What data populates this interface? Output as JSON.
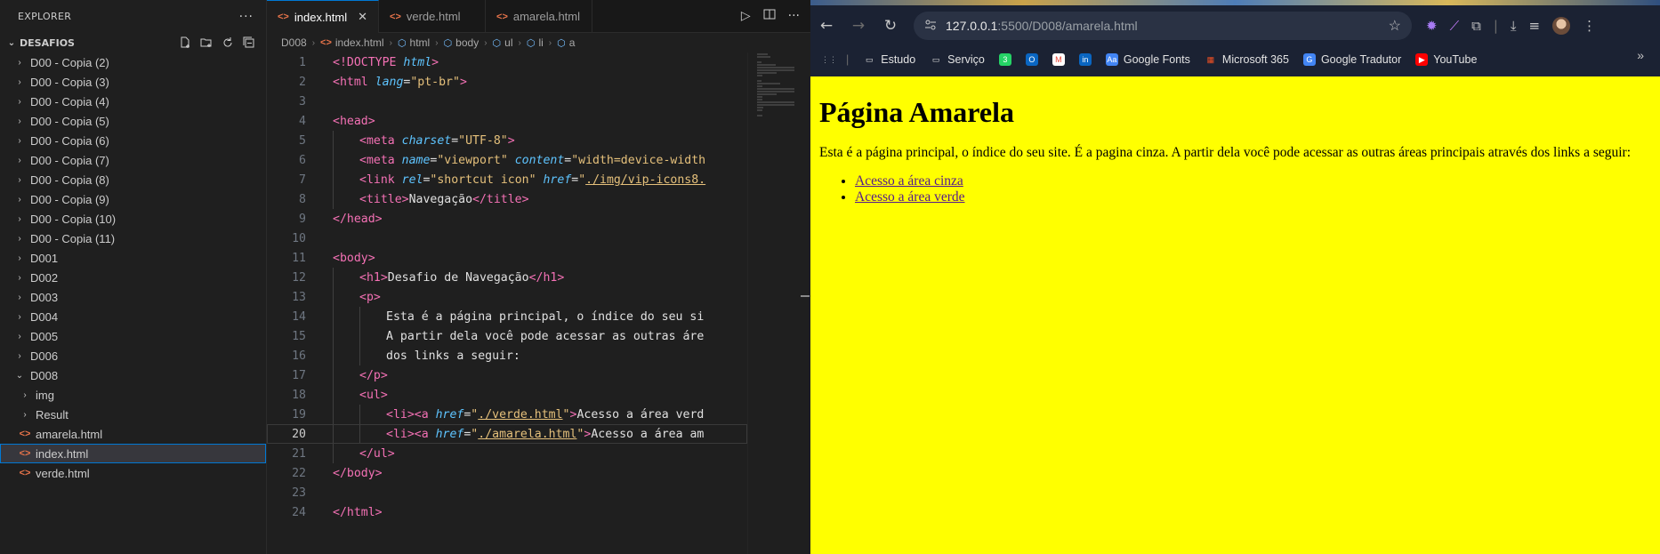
{
  "explorer": {
    "title": "EXPLORER",
    "more": "···",
    "folder": "DESAFIOS",
    "items": [
      {
        "label": "D00 - Copia (2)",
        "kind": "folder",
        "open": false,
        "depth": 1
      },
      {
        "label": "D00 - Copia (3)",
        "kind": "folder",
        "open": false,
        "depth": 1
      },
      {
        "label": "D00 - Copia (4)",
        "kind": "folder",
        "open": false,
        "depth": 1
      },
      {
        "label": "D00 - Copia (5)",
        "kind": "folder",
        "open": false,
        "depth": 1
      },
      {
        "label": "D00 - Copia (6)",
        "kind": "folder",
        "open": false,
        "depth": 1
      },
      {
        "label": "D00 - Copia (7)",
        "kind": "folder",
        "open": false,
        "depth": 1
      },
      {
        "label": "D00 - Copia (8)",
        "kind": "folder",
        "open": false,
        "depth": 1
      },
      {
        "label": "D00 - Copia (9)",
        "kind": "folder",
        "open": false,
        "depth": 1
      },
      {
        "label": "D00 - Copia (10)",
        "kind": "folder",
        "open": false,
        "depth": 1
      },
      {
        "label": "D00 - Copia (11)",
        "kind": "folder",
        "open": false,
        "depth": 1
      },
      {
        "label": "D001",
        "kind": "folder",
        "open": false,
        "depth": 1
      },
      {
        "label": "D002",
        "kind": "folder",
        "open": false,
        "depth": 1
      },
      {
        "label": "D003",
        "kind": "folder",
        "open": false,
        "depth": 1
      },
      {
        "label": "D004",
        "kind": "folder",
        "open": false,
        "depth": 1
      },
      {
        "label": "D005",
        "kind": "folder",
        "open": false,
        "depth": 1
      },
      {
        "label": "D006",
        "kind": "folder",
        "open": false,
        "depth": 1
      },
      {
        "label": "D008",
        "kind": "folder",
        "open": true,
        "depth": 1
      },
      {
        "label": "img",
        "kind": "folder",
        "open": false,
        "depth": 2
      },
      {
        "label": "Result",
        "kind": "folder",
        "open": false,
        "depth": 2
      },
      {
        "label": "amarela.html",
        "kind": "file",
        "depth": 2
      },
      {
        "label": "index.html",
        "kind": "file",
        "depth": 2,
        "selected": true
      },
      {
        "label": "verde.html",
        "kind": "file",
        "depth": 2
      }
    ]
  },
  "tabs": [
    {
      "label": "index.html",
      "active": true
    },
    {
      "label": "verde.html",
      "active": false
    },
    {
      "label": "amarela.html",
      "active": false
    }
  ],
  "breadcrumb": [
    "D008",
    "index.html",
    "html",
    "body",
    "ul",
    "li",
    "a"
  ],
  "code_lines": [
    [
      [
        "t-doc",
        "<!DOCTYPE "
      ],
      [
        "t-dochtml",
        "html"
      ],
      [
        "t-doc",
        ">"
      ]
    ],
    [
      [
        "t-tag",
        "<html "
      ],
      [
        "t-attr",
        "lang"
      ],
      [
        "t-text",
        "="
      ],
      [
        "t-str",
        "\"pt-br\""
      ],
      [
        "t-tag",
        ">"
      ]
    ],
    [],
    [
      [
        "t-tag",
        "<head>"
      ]
    ],
    [
      [
        "g",
        ""
      ],
      [
        "t-tag",
        "<meta "
      ],
      [
        "t-attr",
        "charset"
      ],
      [
        "t-text",
        "="
      ],
      [
        "t-str",
        "\"UTF-8\""
      ],
      [
        "t-tag",
        ">"
      ]
    ],
    [
      [
        "g",
        ""
      ],
      [
        "t-tag",
        "<meta "
      ],
      [
        "t-attr",
        "name"
      ],
      [
        "t-text",
        "="
      ],
      [
        "t-str",
        "\"viewport\" "
      ],
      [
        "t-attr",
        "content"
      ],
      [
        "t-text",
        "="
      ],
      [
        "t-str",
        "\"width=device-width"
      ]
    ],
    [
      [
        "g",
        ""
      ],
      [
        "t-tag",
        "<link "
      ],
      [
        "t-attr",
        "rel"
      ],
      [
        "t-text",
        "="
      ],
      [
        "t-str",
        "\"shortcut icon\" "
      ],
      [
        "t-attr",
        "href"
      ],
      [
        "t-text",
        "="
      ],
      [
        "t-str",
        "\""
      ],
      [
        "t-str t-link",
        "./img/vip-icons8."
      ]
    ],
    [
      [
        "g",
        ""
      ],
      [
        "t-tag",
        "<title>"
      ],
      [
        "t-text",
        "Navegação"
      ],
      [
        "t-tag",
        "</title>"
      ]
    ],
    [
      [
        "t-tag",
        "</head>"
      ]
    ],
    [],
    [
      [
        "t-tag",
        "<body>"
      ]
    ],
    [
      [
        "g",
        ""
      ],
      [
        "t-tag",
        "<h1>"
      ],
      [
        "t-text",
        "Desafio de Navegação"
      ],
      [
        "t-tag",
        "</h1>"
      ]
    ],
    [
      [
        "g",
        ""
      ],
      [
        "t-tag",
        "<p>"
      ]
    ],
    [
      [
        "g",
        ""
      ],
      [
        "g",
        ""
      ],
      [
        "t-text",
        "Esta é a página principal, o índice do seu si"
      ]
    ],
    [
      [
        "g",
        ""
      ],
      [
        "g",
        ""
      ],
      [
        "t-text",
        "A partir dela você pode acessar as outras áre"
      ]
    ],
    [
      [
        "g",
        ""
      ],
      [
        "g",
        ""
      ],
      [
        "t-text",
        "dos links a seguir:"
      ]
    ],
    [
      [
        "g",
        ""
      ],
      [
        "t-tag",
        "</p>"
      ]
    ],
    [
      [
        "g",
        ""
      ],
      [
        "t-tag",
        "<ul>"
      ]
    ],
    [
      [
        "g",
        ""
      ],
      [
        "g",
        ""
      ],
      [
        "t-tag",
        "<li><a "
      ],
      [
        "t-attr",
        "href"
      ],
      [
        "t-text",
        "="
      ],
      [
        "t-str",
        "\""
      ],
      [
        "t-str t-link",
        "./verde.html"
      ],
      [
        "t-str",
        "\""
      ],
      [
        "t-tag",
        ">"
      ],
      [
        "t-text",
        "Acesso a área verd"
      ]
    ],
    [
      [
        "g",
        ""
      ],
      [
        "g",
        ""
      ],
      [
        "t-tag",
        "<li><a "
      ],
      [
        "t-attr",
        "href"
      ],
      [
        "t-text",
        "="
      ],
      [
        "t-str",
        "\""
      ],
      [
        "t-str t-link",
        "./amarela.html"
      ],
      [
        "t-str",
        "\""
      ],
      [
        "t-tag",
        ">"
      ],
      [
        "t-text",
        "Acesso a área am"
      ]
    ],
    [
      [
        "g",
        ""
      ],
      [
        "t-tag",
        "</ul>"
      ]
    ],
    [
      [
        "t-tag",
        "</body>"
      ]
    ],
    [],
    [
      [
        "t-tag",
        "</html>"
      ]
    ]
  ],
  "current_line": 20,
  "browser": {
    "url_host": "127.0.0.1",
    "url_path": ":5500/D008/amarela.html",
    "bookmarks": [
      {
        "label": "",
        "icon": "apps-icon"
      },
      {
        "label": "Estudo",
        "icon": "folder-icon"
      },
      {
        "label": "Serviço",
        "icon": "folder-icon"
      },
      {
        "label": "",
        "icon": "whatsapp-icon"
      },
      {
        "label": "",
        "icon": "outlook-icon"
      },
      {
        "label": "",
        "icon": "gmail-icon"
      },
      {
        "label": "",
        "icon": "linkedin-icon"
      },
      {
        "label": "Google Fonts",
        "icon": "google-fonts-icon"
      },
      {
        "label": "Microsoft 365",
        "icon": "microsoft-icon"
      },
      {
        "label": "Google Tradutor",
        "icon": "google-translate-icon"
      },
      {
        "label": "YouTube",
        "icon": "youtube-icon"
      }
    ],
    "page": {
      "heading": "Página Amarela",
      "paragraph": "Esta é a página principal, o índice do seu site. É a pagina cinza. A partir dela você pode acessar as outras áreas principais através dos links a seguir:",
      "links": [
        "Acesso a área cinza",
        "Acesso a área verde"
      ],
      "background": "#ffff00"
    }
  }
}
